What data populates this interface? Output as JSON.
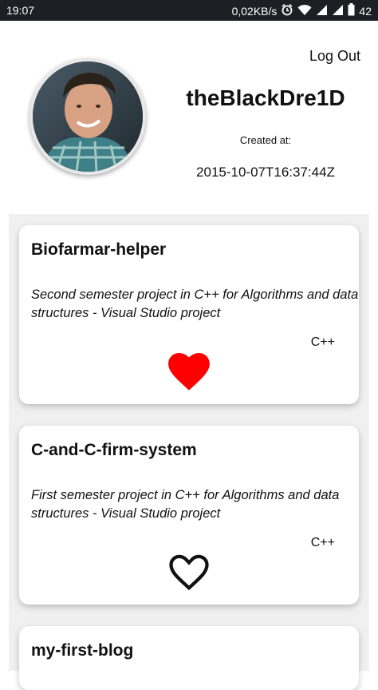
{
  "status_bar": {
    "time": "19:07",
    "network_speed": "0,02KB/s",
    "battery": "42"
  },
  "header": {
    "logout_label": "Log Out",
    "username": "theBlackDre1D",
    "created_label": "Created at:",
    "created_value": "2015-10-07T16:37:44Z"
  },
  "repos": [
    {
      "title": "Biofarmar-helper",
      "description": "Second semester project in C++ for Algorithms and data structures - Visual Studio project",
      "language": "C++",
      "favorite": true
    },
    {
      "title": "C-and-C-firm-system",
      "description": "First semester project in C++ for Algorithms and data structures - Visual Studio project",
      "language": "C++",
      "favorite": false
    },
    {
      "title": "my-first-blog"
    }
  ],
  "colors": {
    "heart_filled": "#ff0000",
    "heart_outline": "#111111",
    "status_bar": "#1c1f24",
    "list_background": "#f0f0f0"
  }
}
